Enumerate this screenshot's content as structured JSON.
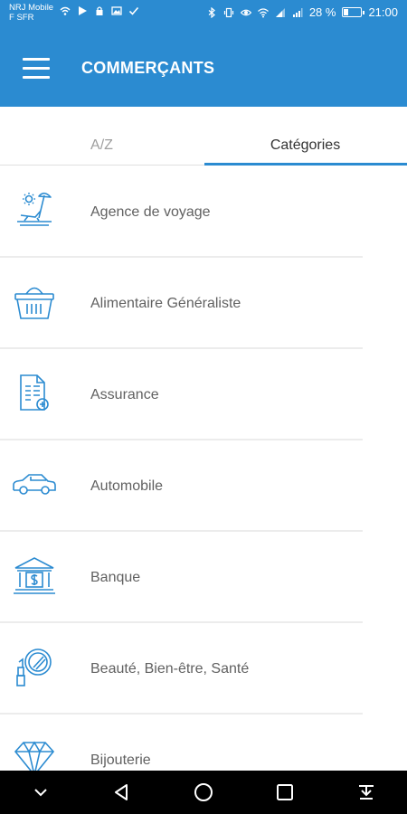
{
  "status_bar": {
    "carrier_line1": "NRJ Mobile",
    "carrier_line2": "F SFR",
    "battery_percent": "28 %",
    "time": "21:00",
    "battery_level": 0.28
  },
  "app_bar": {
    "title": "COMMERÇANTS",
    "menu_icon": "hamburger-menu-icon"
  },
  "tabs": [
    {
      "label": "A/Z",
      "active": false
    },
    {
      "label": "Catégories",
      "active": true
    }
  ],
  "categories": [
    {
      "label": "Agence de voyage",
      "icon": "beach-lounger-icon"
    },
    {
      "label": "Alimentaire Généraliste",
      "icon": "shopping-basket-icon"
    },
    {
      "label": "Assurance",
      "icon": "document-plus-icon"
    },
    {
      "label": "Automobile",
      "icon": "car-icon"
    },
    {
      "label": "Banque",
      "icon": "bank-icon"
    },
    {
      "label": "Beauté, Bien-être, Santé",
      "icon": "beauty-mirror-icon"
    },
    {
      "label": "Bijouterie",
      "icon": "diamond-icon"
    }
  ],
  "colors": {
    "primary": "#2b8bd1",
    "icon": "#2b8bd1",
    "text": "#616161",
    "divider": "#ececec"
  },
  "nav_bar": {
    "icons": [
      "collapse-icon",
      "back-icon",
      "home-icon",
      "recents-icon",
      "notification-pull-icon"
    ]
  }
}
